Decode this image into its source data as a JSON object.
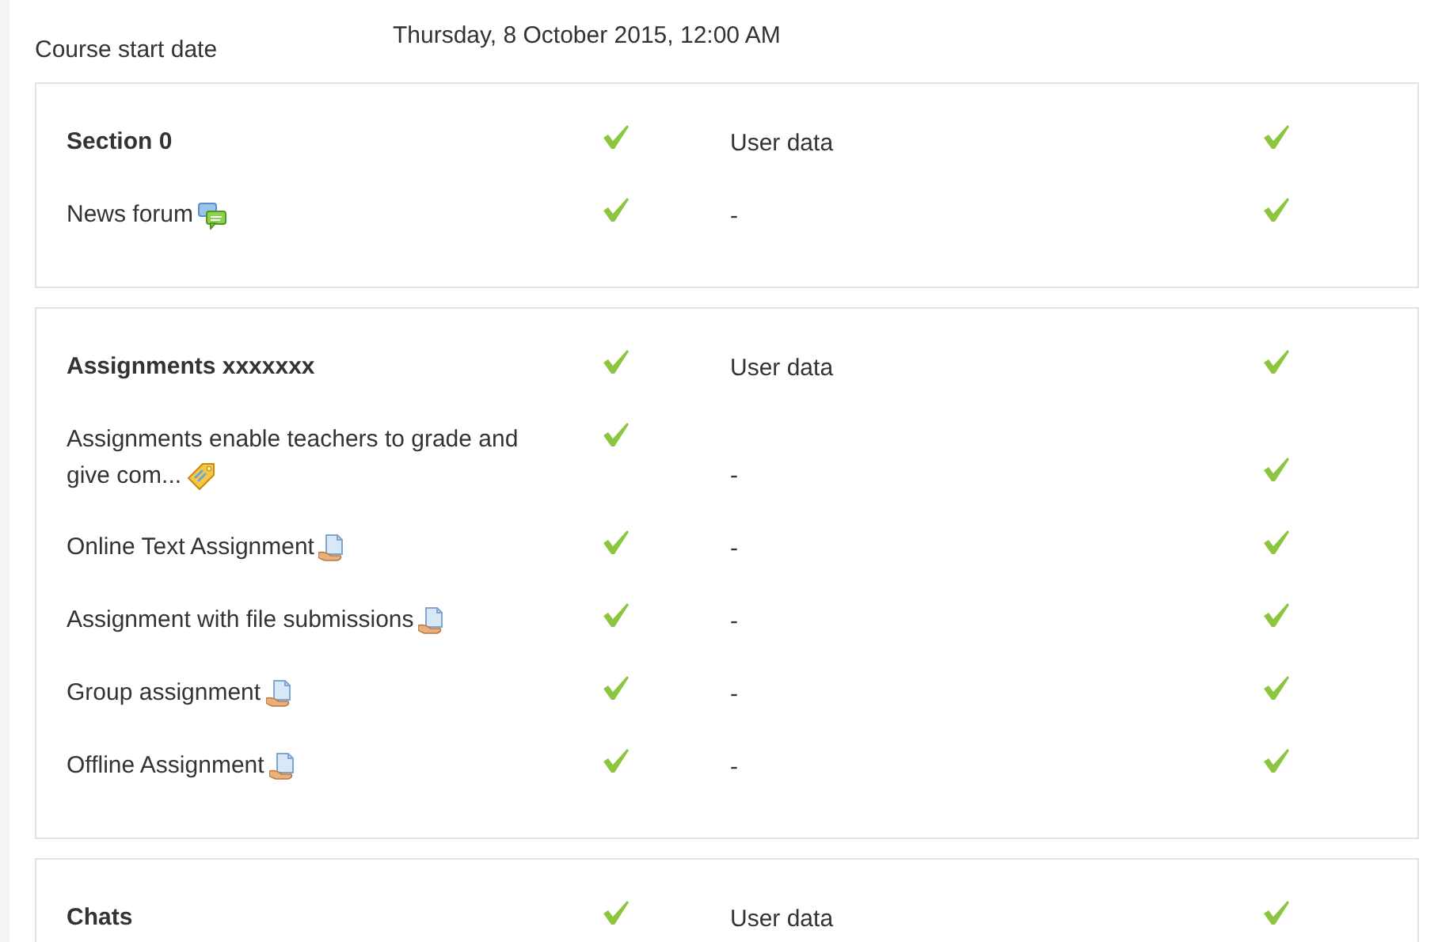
{
  "course_start": {
    "label": "Course start date",
    "value": "Thursday, 8 October 2015, 12:00 AM"
  },
  "sections": [
    {
      "rows": [
        {
          "kind": "header",
          "name": "Section 0",
          "included": true,
          "user_data": "User data",
          "user_included": true
        },
        {
          "kind": "forum",
          "name": "News forum",
          "included": true,
          "user_data": "-",
          "user_included": true
        }
      ]
    },
    {
      "rows": [
        {
          "kind": "header",
          "name": "Assignments xxxxxxx",
          "included": true,
          "user_data": "User data",
          "user_included": true
        },
        {
          "kind": "label",
          "name": "Assignments enable teachers to grade and give com...",
          "included": true,
          "user_data": "-",
          "user_included": true
        },
        {
          "kind": "assign",
          "name": "Online Text Assignment",
          "included": true,
          "user_data": "-",
          "user_included": true
        },
        {
          "kind": "assign",
          "name": "Assignment with file submissions",
          "included": true,
          "user_data": "-",
          "user_included": true
        },
        {
          "kind": "assign",
          "name": "Group assignment",
          "included": true,
          "user_data": "-",
          "user_included": true
        },
        {
          "kind": "assign",
          "name": "Offline Assignment",
          "included": true,
          "user_data": "-",
          "user_included": true
        }
      ]
    },
    {
      "rows": [
        {
          "kind": "header",
          "name": "Chats",
          "included": true,
          "user_data": "User data",
          "user_included": true
        }
      ]
    }
  ]
}
